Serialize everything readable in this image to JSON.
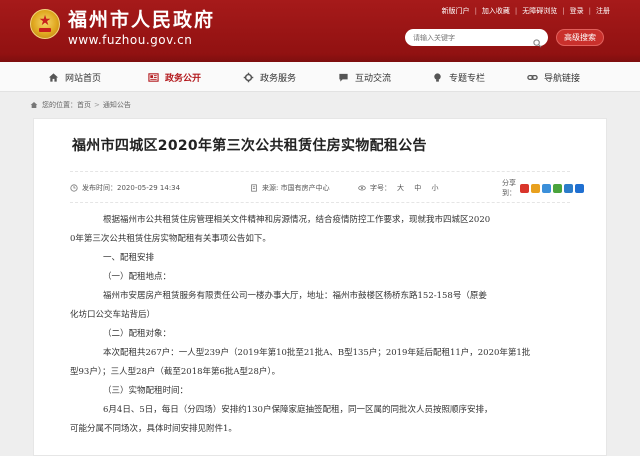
{
  "header": {
    "site_title": "福州市人民政府",
    "site_domain": "www.fuzhou.gov.cn",
    "top_links": [
      "新版门户",
      "加入收藏",
      "无障碍浏览",
      "登录",
      "注册"
    ],
    "search_placeholder": "请输入关键字",
    "advanced_search_label": "高级搜索",
    "brand_color": "#a61a1a"
  },
  "nav": {
    "items": [
      {
        "label": "网站首页",
        "icon": "home-icon"
      },
      {
        "label": "政务公开",
        "icon": "newspaper-icon",
        "active": true
      },
      {
        "label": "政务服务",
        "icon": "gear-icon"
      },
      {
        "label": "互动交流",
        "icon": "chat-icon"
      },
      {
        "label": "专题专栏",
        "icon": "lightbulb-icon"
      },
      {
        "label": "导航链接",
        "icon": "link-icon"
      }
    ]
  },
  "breadcrumb": {
    "label": "您的位置：",
    "items": [
      "首页",
      "通知公告"
    ]
  },
  "article": {
    "title": "福州市四城区2020年第三次公共租赁住房实物配租公告",
    "publish_time": "发布时间：2020-05-29 14:34",
    "source": "来源: 市国有房产中心",
    "font_size_label": "字号：",
    "font_sizes": [
      "大",
      "中",
      "小"
    ],
    "share_label": "分享到：",
    "share_icon_colors": [
      "#d9352b",
      "#e8a01e",
      "#3b8fd9",
      "#4aa43c",
      "#2c7cc9",
      "#1f6fd1"
    ],
    "paragraphs": [
      {
        "style": "indent",
        "text": "根据福州市公共租赁住房管理相关文件精神和房源情况，结合疫情防控工作要求，现就我市四城区2020"
      },
      {
        "style": "cont",
        "text": "0年第三次公共租赁住房实物配租有关事项公告如下。"
      },
      {
        "style": "h1",
        "text": "一、配租安排"
      },
      {
        "style": "h2",
        "text": "（一）配租地点："
      },
      {
        "style": "indent",
        "text": "福州市安居房产租赁服务有限责任公司一楼办事大厅，地址：福州市鼓楼区杨桥东路152-158号（原姜"
      },
      {
        "style": "cont",
        "text": "化坊口公交车站背后）"
      },
      {
        "style": "h2",
        "text": "（二）配租对象："
      },
      {
        "style": "indent",
        "text": "本次配租共267户：一人型239户（2019年第10批至21批A、B型135户；2019年延后配租11户，2020年第1批"
      },
      {
        "style": "cont",
        "text": "型93户）；三人型28户（截至2018年第6批A型28户）。"
      },
      {
        "style": "h2",
        "text": "（三）实物配租时间："
      },
      {
        "style": "indent",
        "text": "6月4日、5日，每日（分四场）安排约130户保障家庭抽签配租，同一区属的同批次人员按照顺序安排，"
      },
      {
        "style": "cont",
        "text": "可能分属不同场次，具体时间安排见附件1。"
      }
    ]
  }
}
